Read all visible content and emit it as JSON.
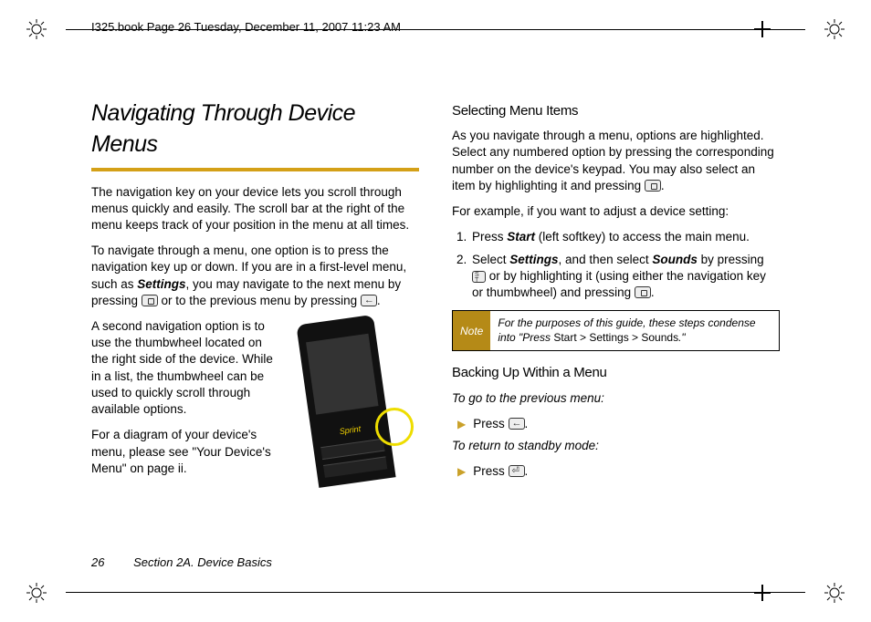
{
  "header": {
    "path": "I325.book  Page 26  Tuesday, December 11, 2007  11:23 AM"
  },
  "left": {
    "title": "Navigating Through Device Menus",
    "p1": "The navigation key on your device lets you scroll through menus quickly and easily. The scroll bar at the right of the menu keeps track of your position in the menu at all times.",
    "p2a": "To navigate through a menu, one option is to press the navigation key up or down. If you are in a first-level menu, such as ",
    "p2_settings": "Settings",
    "p2b": ", you may navigate to the next menu by pressing ",
    "p2c": " or to the previous menu by pressing ",
    "p2d": ".",
    "p3": "A second navigation option is to use the thumbwheel located on the right side of the device. While in a list, the thumbwheel can be used to quickly scroll through available options.",
    "p4": "For a diagram of your device's menu, please see \"Your Device's Menu\" on page ii.",
    "device_logo": "Sprint"
  },
  "right": {
    "h_select": "Selecting Menu Items",
    "sel_p1a": "As you navigate through a menu, options are highlighted. Select any numbered option by pressing the corresponding number on the device's keypad. You may also select an item by highlighting it and pressing ",
    "sel_p1b": ".",
    "sel_p2": "For example, if you want to adjust a device setting:",
    "steps": [
      {
        "a": "Press ",
        "b_bold": "Start",
        "c": " (left softkey) to access the main menu."
      },
      {
        "a": "Select ",
        "b_bold": "Settings",
        "c": ", and then select ",
        "d_bold": "Sounds",
        "e": " by pressing ",
        "f": " or by highlighting it (using either the navigation key or thumbwheel) and pressing ",
        "g": "."
      }
    ],
    "note_label": "Note",
    "note_a": "For the purposes of this guide, these steps condense into \"Press ",
    "note_crumb": "Start > Settings > Sounds",
    "note_b": ".\"",
    "h_back": "Backing Up Within a Menu",
    "back_intro": "To go to the previous menu:",
    "back_press": "Press ",
    "back_dot": ".",
    "standby_intro": "To return to standby mode:",
    "standby_press": "Press ",
    "standby_dot": "."
  },
  "footer": {
    "page": "26",
    "section": "Section 2A. Device Basics"
  }
}
